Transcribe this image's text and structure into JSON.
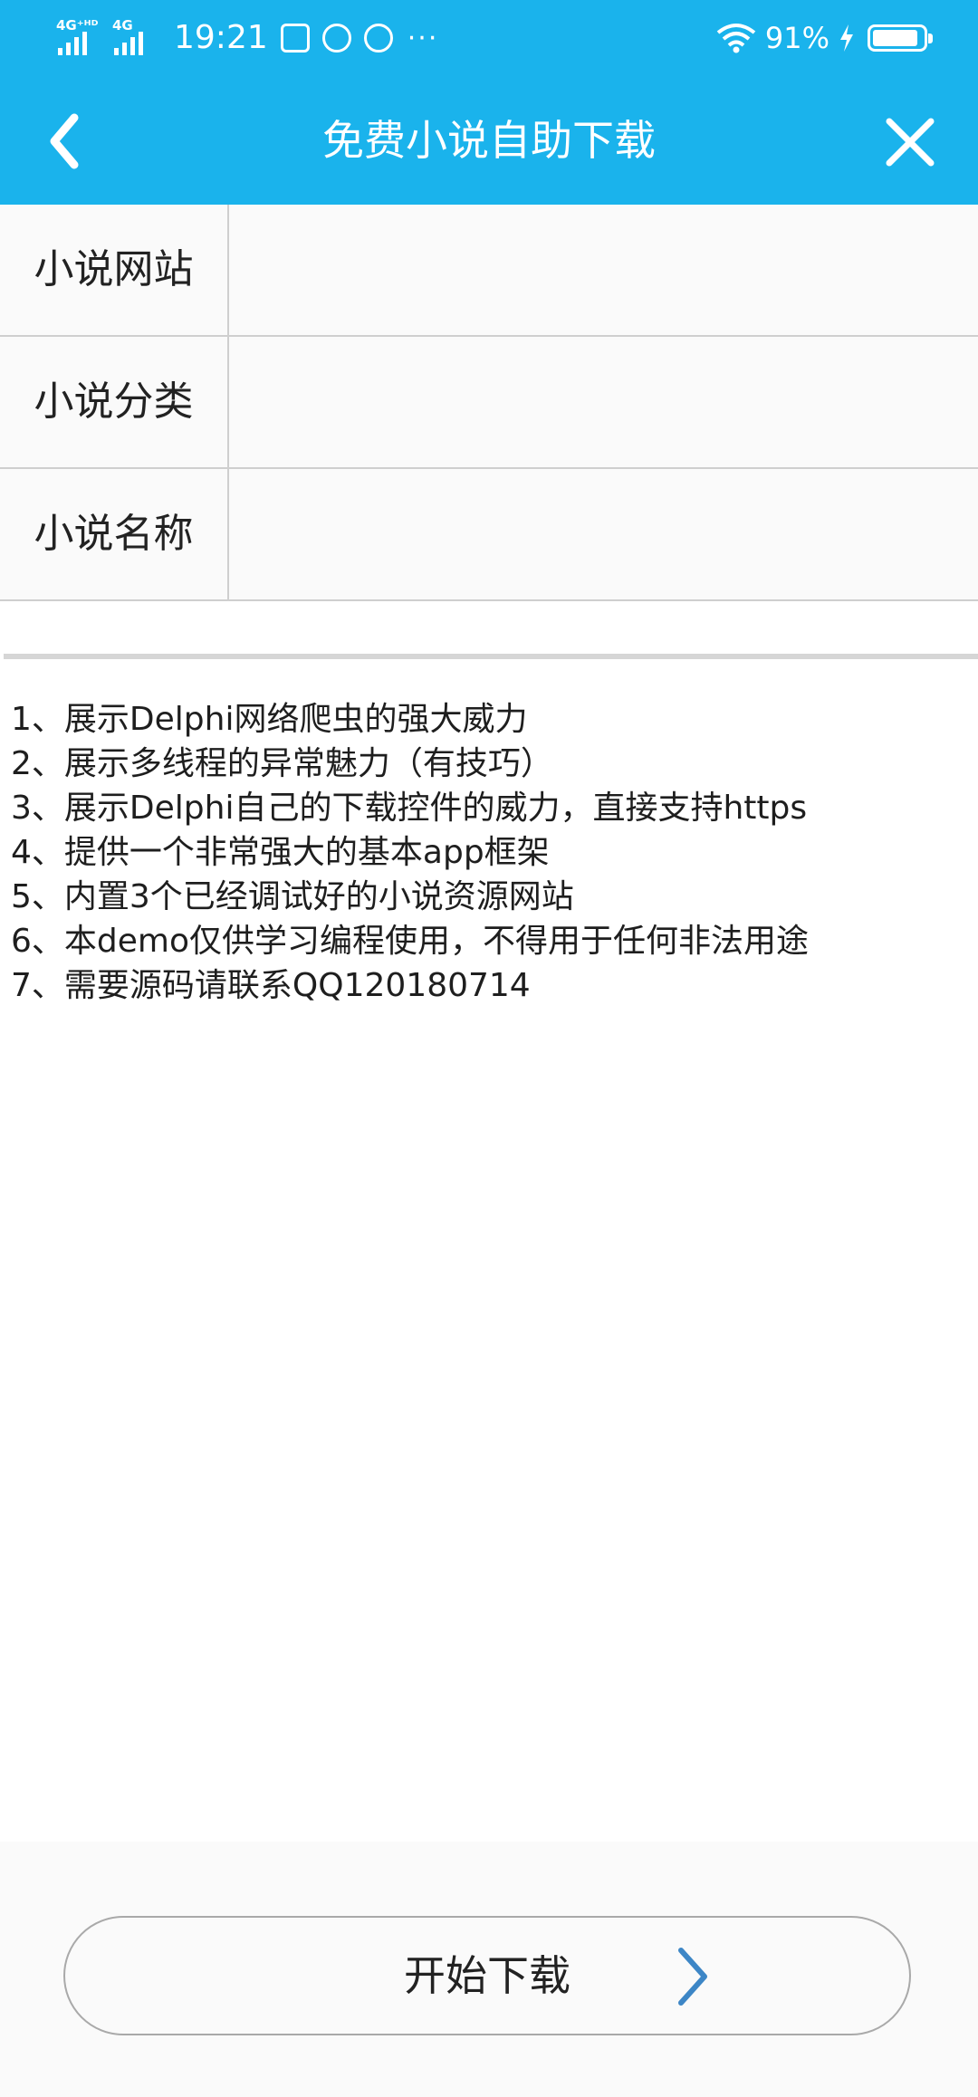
{
  "status_bar": {
    "net1": "4G⁺ᴴᴰ",
    "net2": "4G",
    "time": "19:21",
    "more": "···",
    "battery_pct": "91%",
    "battery_level": 0.91
  },
  "header": {
    "title": "免费小说自助下载",
    "back_icon": "chevron-left-icon",
    "close_icon": "close-icon"
  },
  "form": {
    "rows": [
      {
        "label": "小说网站",
        "value": ""
      },
      {
        "label": "小说分类",
        "value": ""
      },
      {
        "label": "小说名称",
        "value": ""
      }
    ]
  },
  "info": {
    "lines": [
      "1、展示Delphi网络爬虫的强大威力",
      "2、展示多线程的异常魅力（有技巧）",
      "3、展示Delphi自己的下载控件的威力，直接支持https",
      "4、提供一个非常强大的基本app框架",
      "5、内置3个已经调试好的小说资源网站",
      "6、本demo仅供学习编程使用，不得用于任何非法用途",
      "7、需要源码请联系QQ120180714"
    ]
  },
  "footer": {
    "start_label": "开始下载",
    "arrow_icon": "chevron-right-icon",
    "arrow_color": "#3d86c6"
  },
  "colors": {
    "header_bg": "#1ab3ec"
  }
}
